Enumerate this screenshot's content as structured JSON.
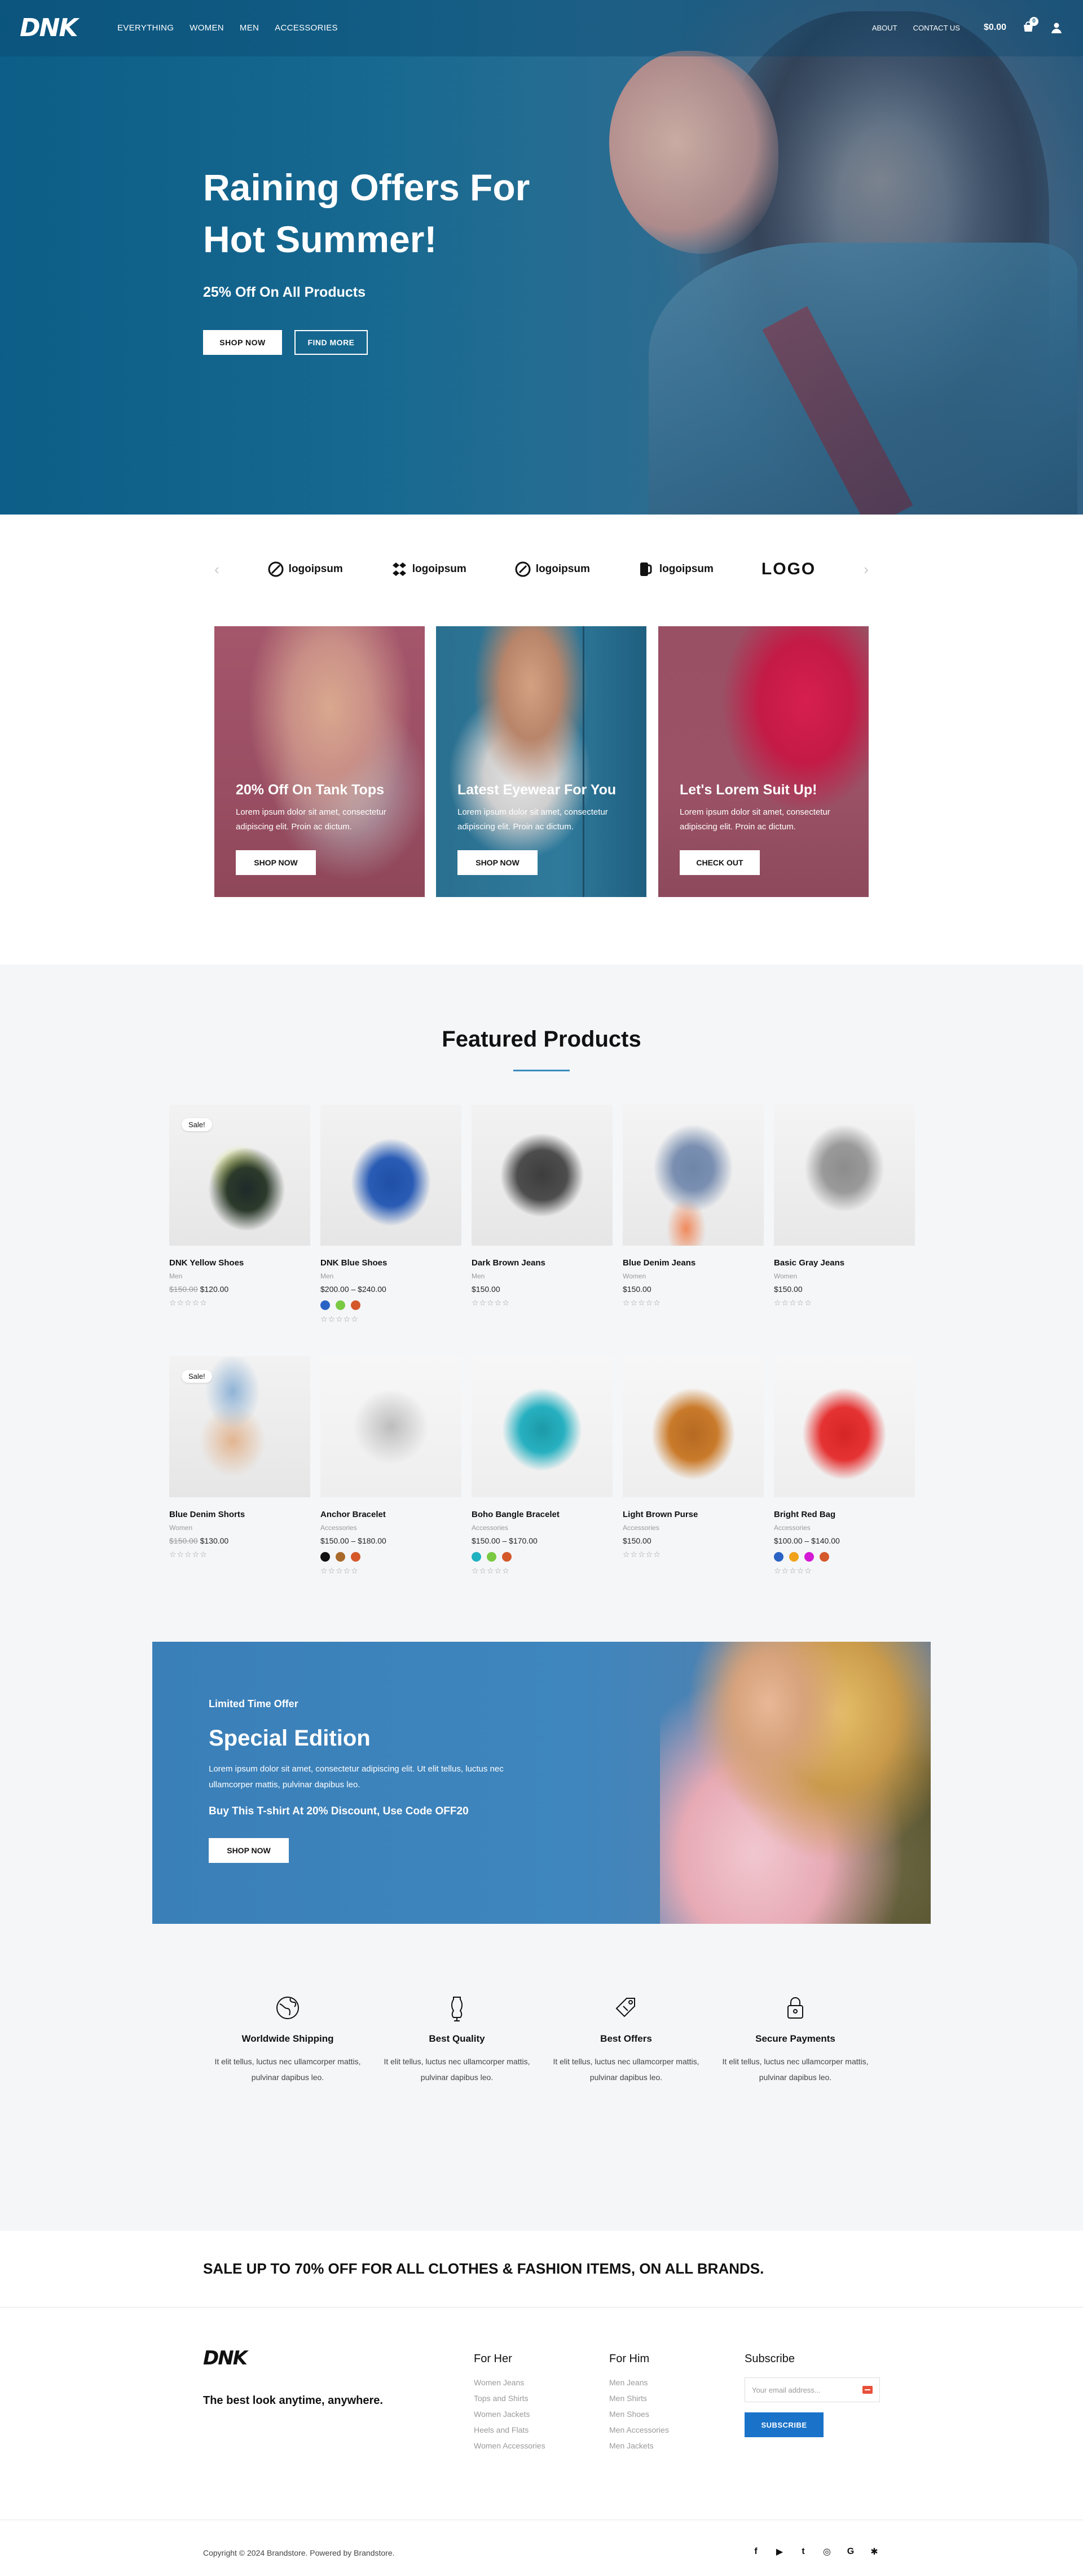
{
  "nav": {
    "logo": "DNK",
    "links": [
      "EVERYTHING",
      "WOMEN",
      "MEN",
      "ACCESSORIES"
    ],
    "right_links": [
      "ABOUT",
      "CONTACT US"
    ],
    "cart_total": "$0.00",
    "cart_count": "0"
  },
  "hero": {
    "title": "Raining Offers For Hot Summer!",
    "subtitle": "25% Off On All Products",
    "primary_button": "SHOP NOW",
    "secondary_button": "FIND MORE"
  },
  "brands": {
    "items": [
      "logoipsum",
      "logoipsum",
      "logoipsum",
      "logoipsum",
      "LOGO"
    ]
  },
  "promos": [
    {
      "title": "20% Off On Tank Tops",
      "desc": "Lorem ipsum dolor sit amet, consectetur adipiscing elit. Proin ac dictum.",
      "button": "SHOP NOW"
    },
    {
      "title": "Latest Eyewear For You",
      "desc": "Lorem ipsum dolor sit amet, consectetur adipiscing elit. Proin ac dictum.",
      "button": "SHOP NOW"
    },
    {
      "title": "Let's Lorem Suit Up!",
      "desc": "Lorem ipsum dolor sit amet, consectetur adipiscing elit. Proin ac dictum.",
      "button": "CHECK OUT"
    }
  ],
  "featured": {
    "title": "Featured Products",
    "sale_label": "Sale!",
    "stars": "☆☆☆☆☆",
    "products": [
      {
        "name": "DNK Yellow Shoes",
        "category": "Men",
        "old_price": "$150.00",
        "price": "$120.00",
        "sale": true,
        "swatches": []
      },
      {
        "name": "DNK Blue Shoes",
        "category": "Men",
        "old_price": "",
        "price": "$200.00 – $240.00",
        "sale": false,
        "swatches": [
          "#2a63c4",
          "#7ac943",
          "#d4582a"
        ]
      },
      {
        "name": "Dark Brown Jeans",
        "category": "Men",
        "old_price": "",
        "price": "$150.00",
        "sale": false,
        "swatches": []
      },
      {
        "name": "Blue Denim Jeans",
        "category": "Women",
        "old_price": "",
        "price": "$150.00",
        "sale": false,
        "swatches": []
      },
      {
        "name": "Basic Gray Jeans",
        "category": "Women",
        "old_price": "",
        "price": "$150.00",
        "sale": false,
        "swatches": []
      },
      {
        "name": "Blue Denim Shorts",
        "category": "Women",
        "old_price": "$150.00",
        "price": "$130.00",
        "sale": true,
        "swatches": []
      },
      {
        "name": "Anchor Bracelet",
        "category": "Accessories",
        "old_price": "",
        "price": "$150.00 – $180.00",
        "sale": false,
        "swatches": [
          "#111111",
          "#a8692a",
          "#d4582a"
        ]
      },
      {
        "name": "Boho Bangle Bracelet",
        "category": "Accessories",
        "old_price": "",
        "price": "$150.00 – $170.00",
        "sale": false,
        "swatches": [
          "#1fb1c0",
          "#7ac943",
          "#d4582a"
        ]
      },
      {
        "name": "Light Brown Purse",
        "category": "Accessories",
        "old_price": "",
        "price": "$150.00",
        "sale": false,
        "swatches": []
      },
      {
        "name": "Bright Red Bag",
        "category": "Accessories",
        "old_price": "",
        "price": "$100.00 – $140.00",
        "sale": false,
        "swatches": [
          "#2a63c4",
          "#f0a21a",
          "#d41ad4",
          "#d4582a"
        ]
      }
    ]
  },
  "special": {
    "label": "Limited Time Offer",
    "title": "Special Edition",
    "desc": "Lorem ipsum dolor sit amet, consectetur adipiscing elit. Ut elit tellus, luctus nec ullamcorper mattis, pulvinar dapibus leo.",
    "offer": "Buy This T-shirt At 20% Discount, Use Code OFF20",
    "button": "SHOP NOW"
  },
  "features": [
    {
      "title": "Worldwide Shipping",
      "desc": "It elit tellus, luctus nec ullamcorper mattis, pulvinar dapibus leo.",
      "icon": "globe-icon"
    },
    {
      "title": "Best Quality",
      "desc": "It elit tellus, luctus nec ullamcorper mattis, pulvinar dapibus leo.",
      "icon": "dress-form-icon"
    },
    {
      "title": "Best Offers",
      "desc": "It elit tellus, luctus nec ullamcorper mattis, pulvinar dapibus leo.",
      "icon": "price-tag-icon"
    },
    {
      "title": "Secure Payments",
      "desc": "It elit tellus, luctus nec ullamcorper mattis, pulvinar dapibus leo.",
      "icon": "lock-icon"
    }
  ],
  "salebar": {
    "text": "SALE UP TO 70% OFF FOR ALL CLOTHES & FASHION ITEMS, ON ALL BRANDS."
  },
  "footer": {
    "logo": "DNK",
    "tagline": "The best look anytime, anywhere.",
    "for_her": {
      "title": "For Her",
      "links": [
        "Women Jeans",
        "Tops and Shirts",
        "Women Jackets",
        "Heels and Flats",
        "Women Accessories"
      ]
    },
    "for_him": {
      "title": "For Him",
      "links": [
        "Men Jeans",
        "Men Shirts",
        "Men Shoes",
        "Men Accessories",
        "Men Jackets"
      ]
    },
    "subscribe": {
      "title": "Subscribe",
      "placeholder": "Your email address...",
      "button": "SUBSCRIBE"
    },
    "copyright": "Copyright © 2024 Brandstore. Powered by Brandstore.",
    "socials": [
      "f",
      "▶",
      "t",
      "◎",
      "G",
      "✱"
    ]
  },
  "colors": {
    "accent": "#1a73c9",
    "hero_blue": "#0d5f88",
    "underline": "#3a8bbf"
  }
}
